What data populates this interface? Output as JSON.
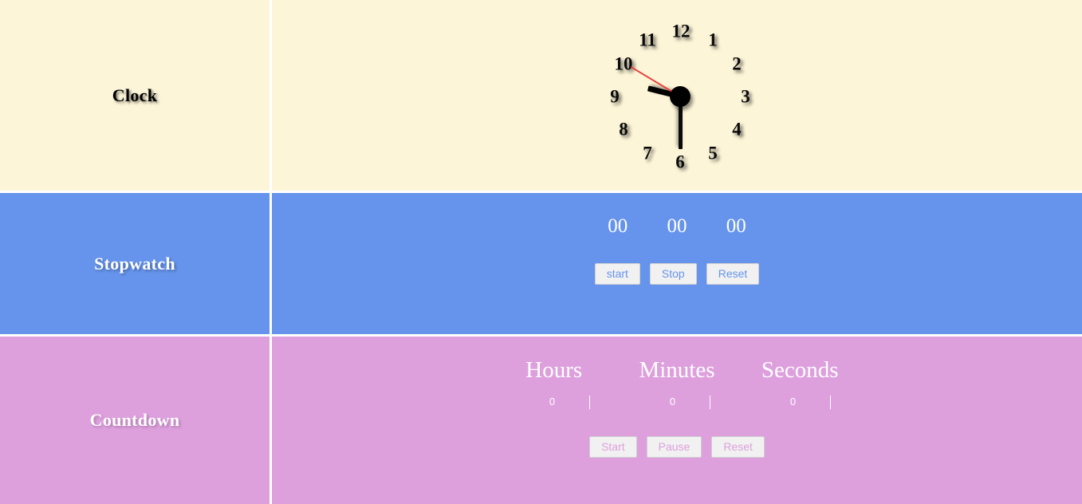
{
  "colors": {
    "clock_bg": "#fdf5d8",
    "stopwatch_bg": "#6694ec",
    "countdown_bg": "#dda0dd",
    "divider": "#ffffff",
    "second_hand": "#e8413c",
    "hand": "#000000",
    "button_bg": "#f1f1f1"
  },
  "sections": {
    "clock": {
      "label": "Clock",
      "numbers": [
        "1",
        "2",
        "3",
        "4",
        "5",
        "6",
        "7",
        "8",
        "9",
        "10",
        "11",
        "12"
      ],
      "hands": {
        "hour_deg": 284,
        "minute_deg": 180,
        "second_deg": 301
      }
    },
    "stopwatch": {
      "label": "Stopwatch",
      "digits": {
        "hours": "00",
        "minutes": "00",
        "seconds": "00"
      },
      "buttons": {
        "start": "start",
        "stop": "Stop",
        "reset": "Reset"
      }
    },
    "countdown": {
      "label": "Countdown",
      "field_labels": {
        "hours": "Hours",
        "minutes": "Minutes",
        "seconds": "Seconds"
      },
      "field_values": {
        "hours": "0",
        "minutes": "0",
        "seconds": "0"
      },
      "buttons": {
        "start": "Start",
        "pause": "Pause",
        "reset": "Reset"
      }
    }
  }
}
